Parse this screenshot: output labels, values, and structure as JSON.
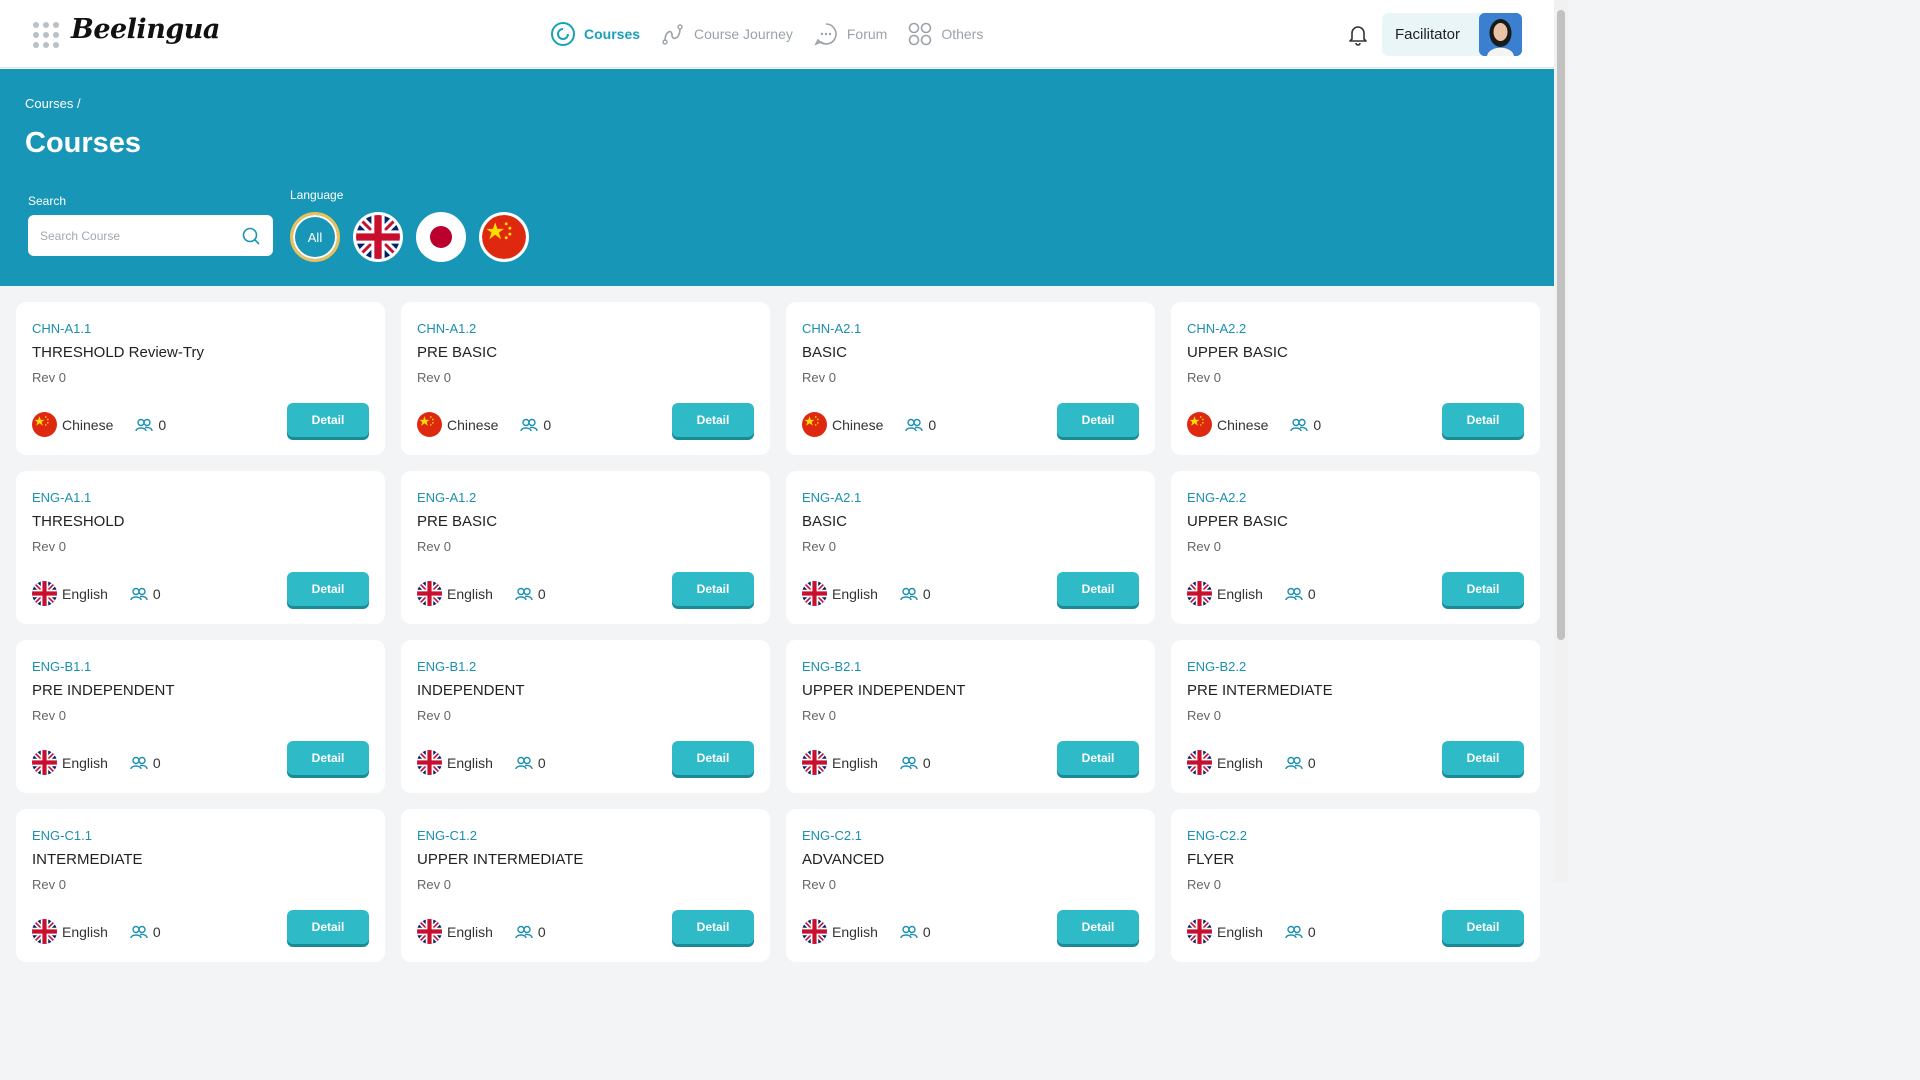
{
  "header": {
    "brand": "Beelingua",
    "nav": [
      {
        "label": "Courses",
        "icon": "courses-icon",
        "active": true
      },
      {
        "label": "Course Journey",
        "icon": "journey-icon",
        "active": false
      },
      {
        "label": "Forum",
        "icon": "chat-icon",
        "active": false
      },
      {
        "label": "Others",
        "icon": "grid-icon",
        "active": false
      }
    ],
    "user_role": "Facilitator"
  },
  "hero": {
    "breadcrumb": "Courses  /",
    "title": "Courses",
    "search_label": "Search",
    "search_placeholder": "Search Course",
    "language_label": "Language",
    "language_all": "All",
    "language_flags": [
      "uk-flag-icon",
      "japan-flag-icon",
      "china-flag-icon"
    ]
  },
  "colors": {
    "accent": "#1896b7",
    "button": "#2fbac8",
    "code_text": "#1a8fb0"
  },
  "cards": [
    {
      "code": "CHN-A1.1",
      "name": "THRESHOLD Review-Try",
      "rev": "Rev 0",
      "language": "Chinese",
      "flag": "cn",
      "users": "0",
      "button": "Detail"
    },
    {
      "code": "CHN-A1.2",
      "name": "PRE BASIC",
      "rev": "Rev 0",
      "language": "Chinese",
      "flag": "cn",
      "users": "0",
      "button": "Detail"
    },
    {
      "code": "CHN-A2.1",
      "name": "BASIC",
      "rev": "Rev 0",
      "language": "Chinese",
      "flag": "cn",
      "users": "0",
      "button": "Detail"
    },
    {
      "code": "CHN-A2.2",
      "name": "UPPER BASIC",
      "rev": "Rev 0",
      "language": "Chinese",
      "flag": "cn",
      "users": "0",
      "button": "Detail"
    },
    {
      "code": "ENG-A1.1",
      "name": "THRESHOLD",
      "rev": "Rev 0",
      "language": "English",
      "flag": "uk",
      "users": "0",
      "button": "Detail"
    },
    {
      "code": "ENG-A1.2",
      "name": "PRE BASIC",
      "rev": "Rev 0",
      "language": "English",
      "flag": "uk",
      "users": "0",
      "button": "Detail"
    },
    {
      "code": "ENG-A2.1",
      "name": "BASIC",
      "rev": "Rev 0",
      "language": "English",
      "flag": "uk",
      "users": "0",
      "button": "Detail"
    },
    {
      "code": "ENG-A2.2",
      "name": "UPPER BASIC",
      "rev": "Rev 0",
      "language": "English",
      "flag": "uk",
      "users": "0",
      "button": "Detail"
    },
    {
      "code": "ENG-B1.1",
      "name": "PRE INDEPENDENT",
      "rev": "Rev 0",
      "language": "English",
      "flag": "uk",
      "users": "0",
      "button": "Detail"
    },
    {
      "code": "ENG-B1.2",
      "name": "INDEPENDENT",
      "rev": "Rev 0",
      "language": "English",
      "flag": "uk",
      "users": "0",
      "button": "Detail"
    },
    {
      "code": "ENG-B2.1",
      "name": "UPPER INDEPENDENT",
      "rev": "Rev 0",
      "language": "English",
      "flag": "uk",
      "users": "0",
      "button": "Detail"
    },
    {
      "code": "ENG-B2.2",
      "name": "PRE INTERMEDIATE",
      "rev": "Rev 0",
      "language": "English",
      "flag": "uk",
      "users": "0",
      "button": "Detail"
    },
    {
      "code": "ENG-C1.1",
      "name": "INTERMEDIATE",
      "rev": "Rev 0",
      "language": "English",
      "flag": "uk",
      "users": "0",
      "button": "Detail"
    },
    {
      "code": "ENG-C1.2",
      "name": "UPPER INTERMEDIATE",
      "rev": "Rev 0",
      "language": "English",
      "flag": "uk",
      "users": "0",
      "button": "Detail"
    },
    {
      "code": "ENG-C2.1",
      "name": "ADVANCED",
      "rev": "Rev 0",
      "language": "English",
      "flag": "uk",
      "users": "0",
      "button": "Detail"
    },
    {
      "code": "ENG-C2.2",
      "name": "FLYER",
      "rev": "Rev 0",
      "language": "English",
      "flag": "uk",
      "users": "0",
      "button": "Detail"
    }
  ]
}
